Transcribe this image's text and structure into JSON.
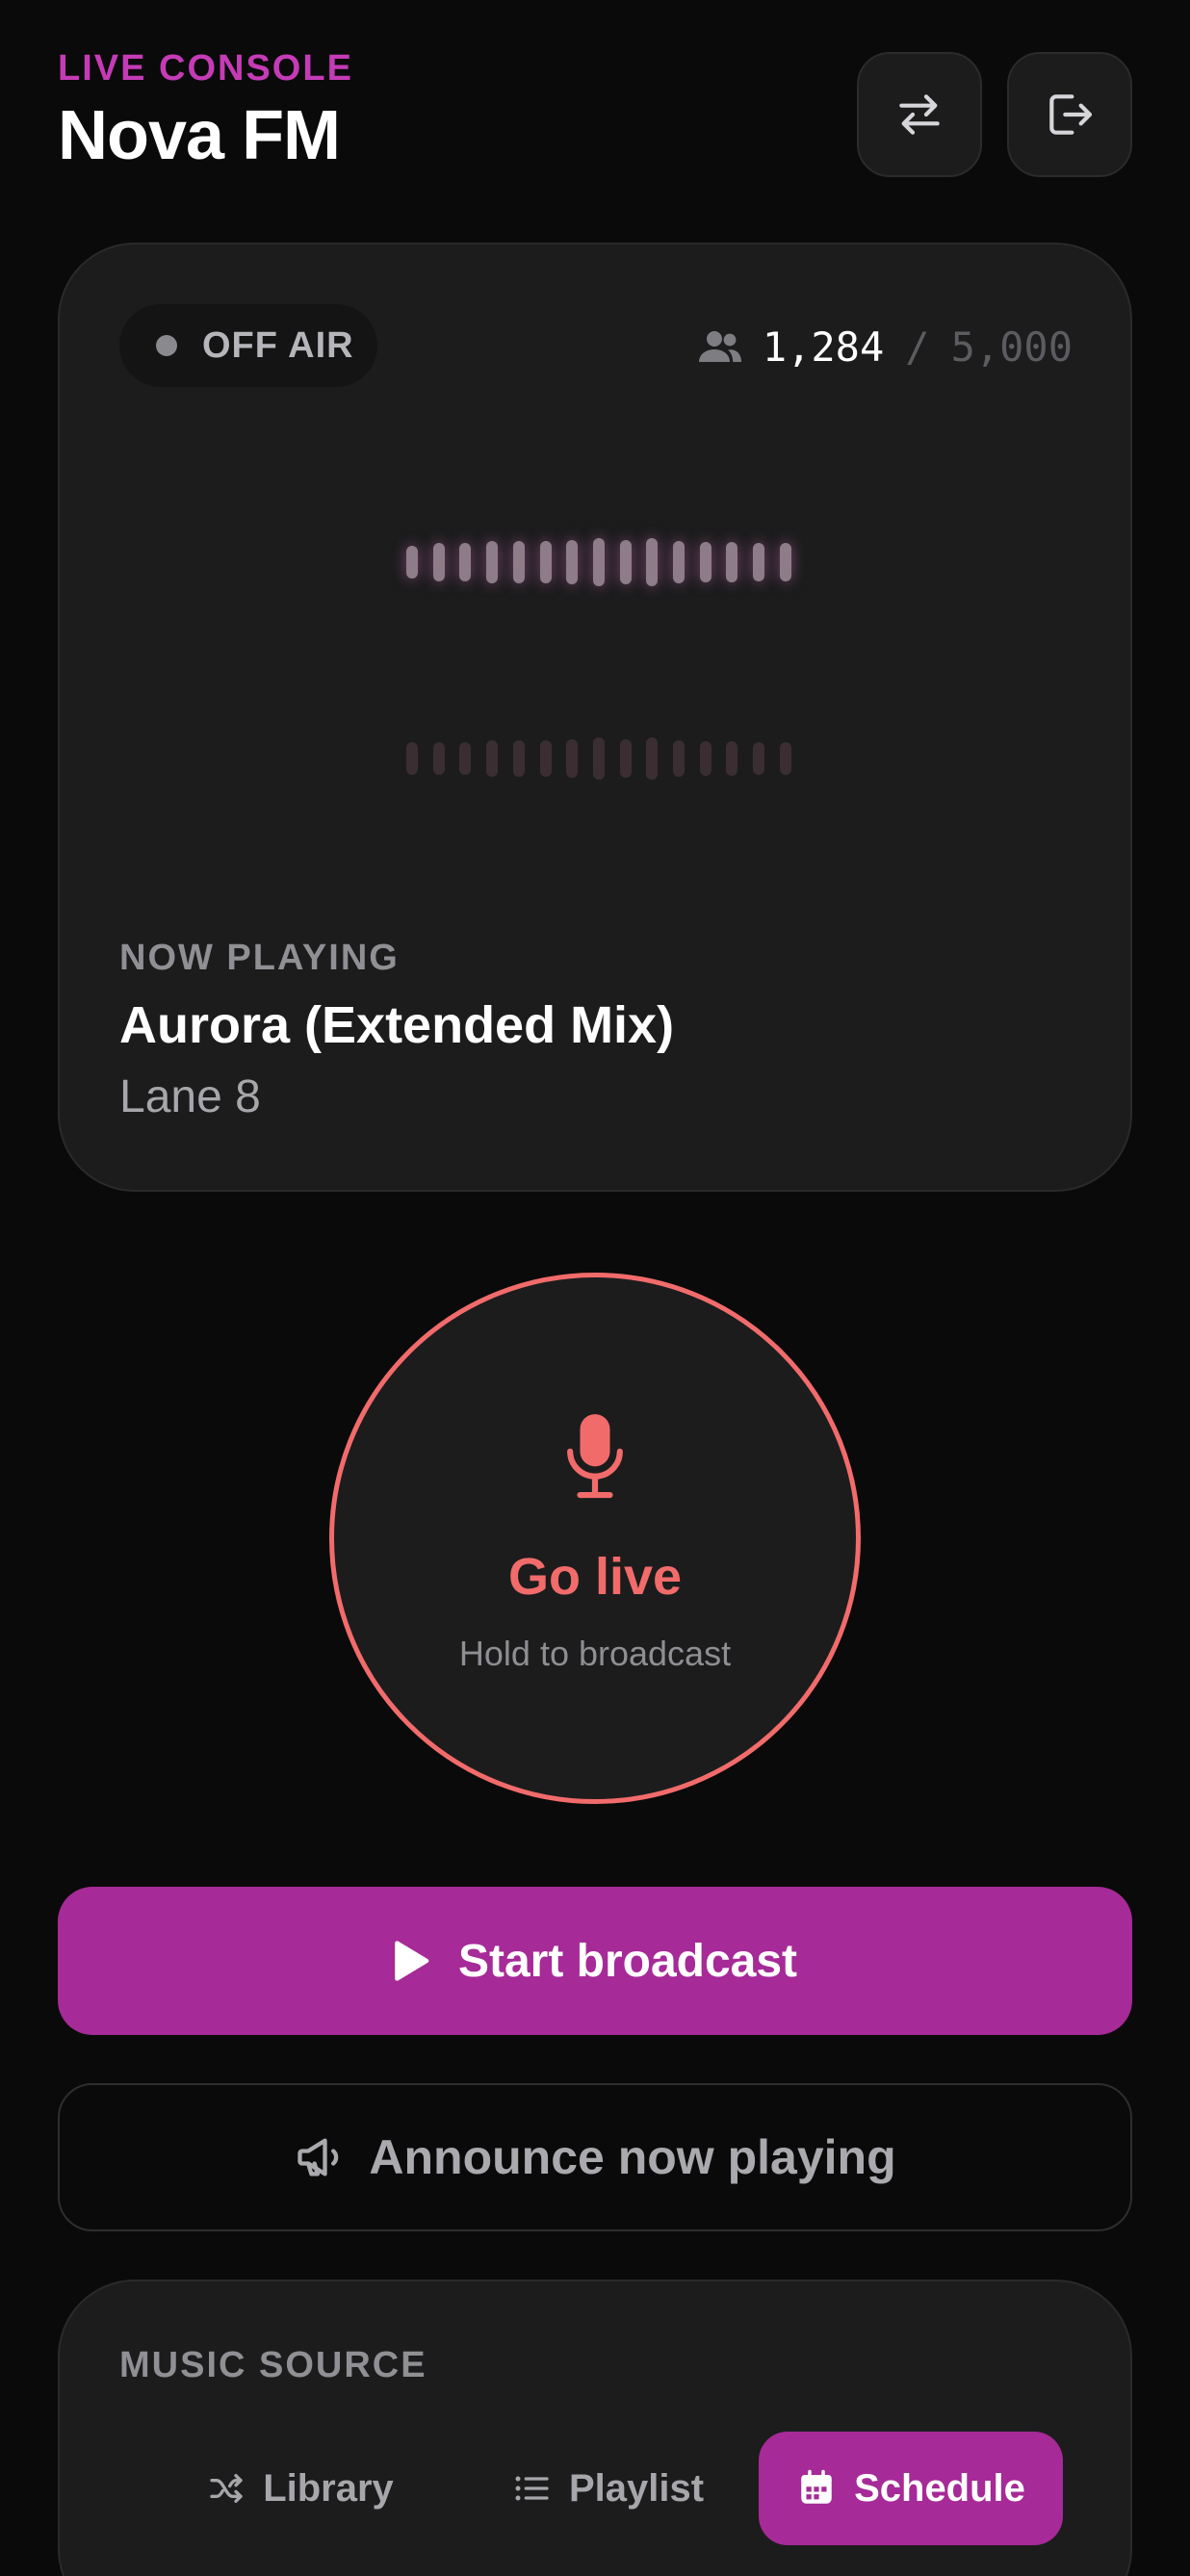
{
  "header": {
    "eyebrow": "LIVE CONSOLE",
    "title": "Nova FM",
    "actions": [
      {
        "name": "swap",
        "icon": "swap-arrows-icon"
      },
      {
        "name": "exit",
        "icon": "exit-icon"
      }
    ]
  },
  "now_playing_card": {
    "status": "OFF AIR",
    "listeners": {
      "current": "1,284",
      "separator": "/",
      "capacity": "5,000",
      "icon": "users-icon"
    },
    "label": "NOW PLAYING",
    "track_title": "Aurora (Extended Mix)",
    "artist": "Lane 8"
  },
  "go_live": {
    "label": "Go live",
    "hint": "Hold to broadcast",
    "icon": "microphone-icon"
  },
  "actions": {
    "primary_label": "Start broadcast",
    "primary_icon": "play-icon",
    "secondary_label": "Announce now playing",
    "secondary_icon": "megaphone-icon"
  },
  "music_source": {
    "label": "MUSIC SOURCE",
    "options": [
      {
        "label": "Library",
        "icon": "shuffle-icon",
        "selected": false
      },
      {
        "label": "Playlist",
        "icon": "list-icon",
        "selected": false
      },
      {
        "label": "Schedule",
        "icon": "calendar-icon",
        "selected": true
      }
    ]
  },
  "colors": {
    "background": "#0a0a0a",
    "card": "#1c1c1d",
    "accent": "#a62a97",
    "eyebrow": "#c53bb6",
    "live_red": "#f26b6b"
  }
}
